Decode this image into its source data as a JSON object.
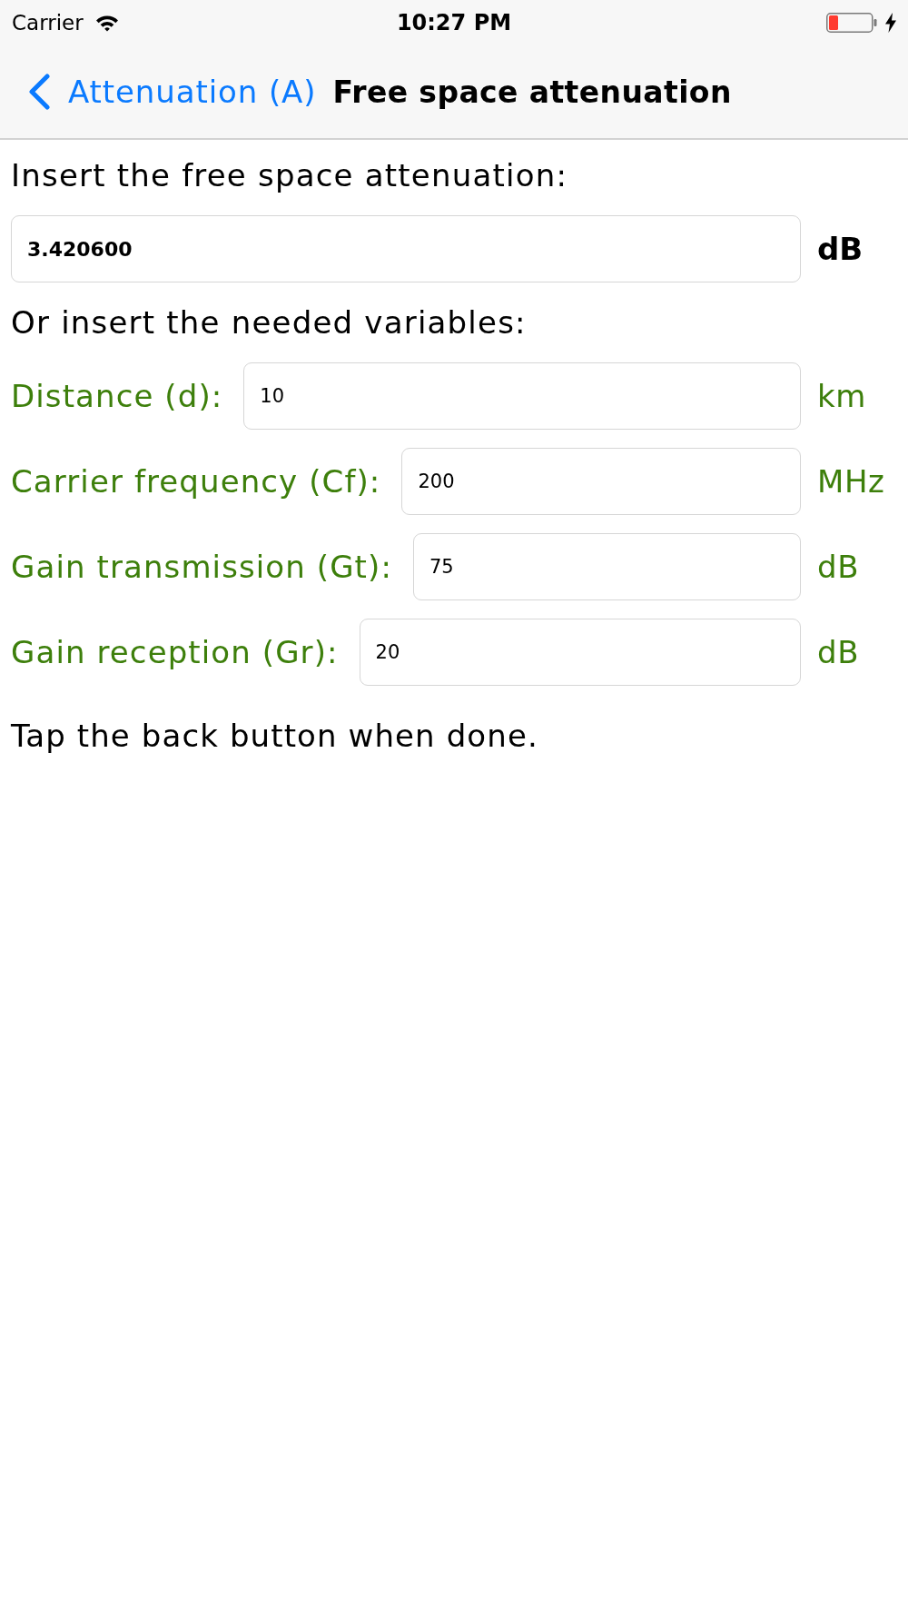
{
  "status_bar": {
    "carrier": "Carrier",
    "time": "10:27 PM"
  },
  "nav_bar": {
    "back_label": "Attenuation (A)",
    "title": "Free space attenuation"
  },
  "attenuation": {
    "prompt": "Insert the free space attenuation:",
    "value": "3.420600",
    "unit": "dB"
  },
  "variables": {
    "prompt": "Or insert the needed variables:",
    "rows": [
      {
        "label": "Distance (d):",
        "value": "10",
        "unit": "km"
      },
      {
        "label": "Carrier frequency (Cf):",
        "value": "200",
        "unit": "MHz"
      },
      {
        "label": "Gain transmission (Gt):",
        "value": "75",
        "unit": "dB"
      },
      {
        "label": "Gain reception (Gr):",
        "value": "20",
        "unit": "dB"
      }
    ]
  },
  "footer_note": "Tap the back button when done."
}
